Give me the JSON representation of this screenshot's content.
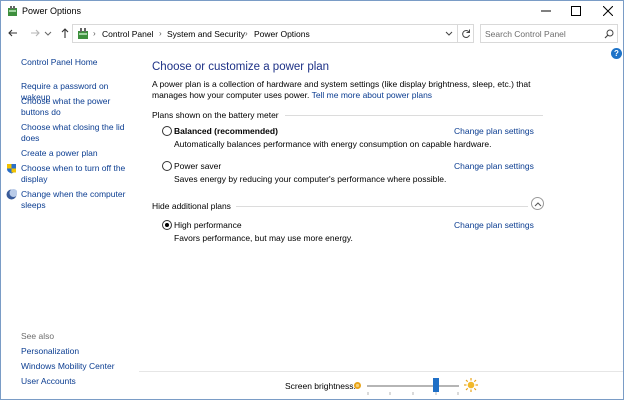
{
  "window": {
    "title": "Power Options",
    "controls": {
      "minimize": "minimize",
      "maximize": "maximize",
      "close": "close"
    }
  },
  "address": {
    "breadcrumbs": [
      "Control Panel",
      "System and Security",
      "Power Options"
    ],
    "search_placeholder": "Search Control Panel"
  },
  "sidebar": {
    "home": "Control Panel Home",
    "links": [
      "Require a password on wakeup",
      "Choose what the power buttons do",
      "Choose what closing the lid does",
      "Create a power plan",
      "Choose when to turn off the display",
      "Change when the computer sleeps"
    ],
    "see_also_label": "See also",
    "see_also": [
      "Personalization",
      "Windows Mobility Center",
      "User Accounts"
    ]
  },
  "main": {
    "heading": "Choose or customize a power plan",
    "intro": "A power plan is a collection of hardware and system settings (like display brightness, sleep, etc.) that manages how your computer uses power.",
    "intro_link": "Tell me more about power plans",
    "battery_group_label": "Plans shown on the battery meter",
    "additional_group_label": "Hide additional plans",
    "change_settings_label": "Change plan settings",
    "plans": [
      {
        "name": "Balanced (recommended)",
        "description": "Automatically balances performance with energy consumption on capable hardware.",
        "selected": false
      },
      {
        "name": "Power saver",
        "description": "Saves energy by reducing your computer's performance where possible.",
        "selected": false
      },
      {
        "name": "High performance",
        "description": "Favors performance, but may use more energy.",
        "selected": true
      }
    ]
  },
  "bottom": {
    "brightness_label": "Screen brightness:",
    "brightness_percent": 75
  },
  "colors": {
    "link": "#0b3d91",
    "heading": "#1e3287",
    "slider_thumb": "#1f6fc6",
    "sun": "#e8a317"
  },
  "icons": {
    "app": "power-options-icon",
    "back": "arrow-left-icon",
    "forward": "arrow-right-icon",
    "up": "arrow-up-icon",
    "refresh": "refresh-icon",
    "search": "search-icon",
    "help": "help-icon",
    "shield": "shield-icon",
    "sleep": "moon-icon",
    "brightness_low": "sun-small-icon",
    "brightness_high": "sun-big-icon"
  }
}
